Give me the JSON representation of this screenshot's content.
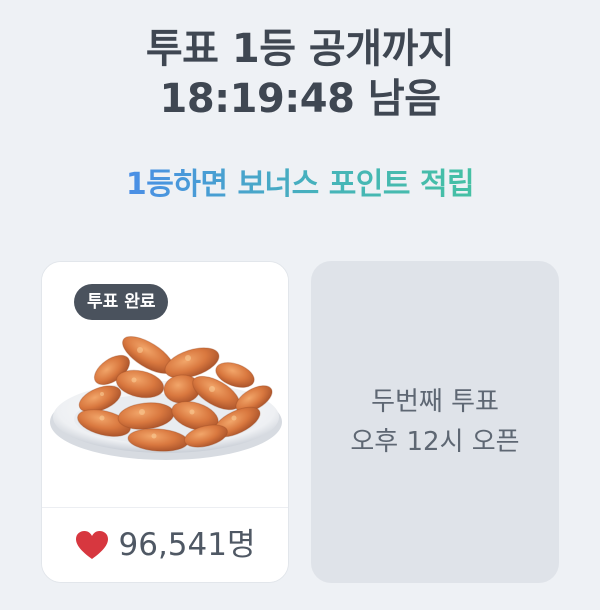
{
  "header": {
    "line1": "투표 1등 공개까지",
    "line2": "18:19:48 남음"
  },
  "subtitle": "1등하면 보너스 포인트 적립",
  "colors": {
    "subtitle_gradient_start": "#4a8ee6",
    "subtitle_gradient_end": "#45c0a4",
    "heart": "#d7373f",
    "badge_bg": "#4a525d"
  },
  "card1": {
    "badge": "투표 완료",
    "image_icon": "fried-chicken-nuggets-photo",
    "heart_icon": "heart-icon",
    "vote_count": "96,541명"
  },
  "card2": {
    "line1": "두번째 투표",
    "line2": "오후 12시 오픈"
  }
}
